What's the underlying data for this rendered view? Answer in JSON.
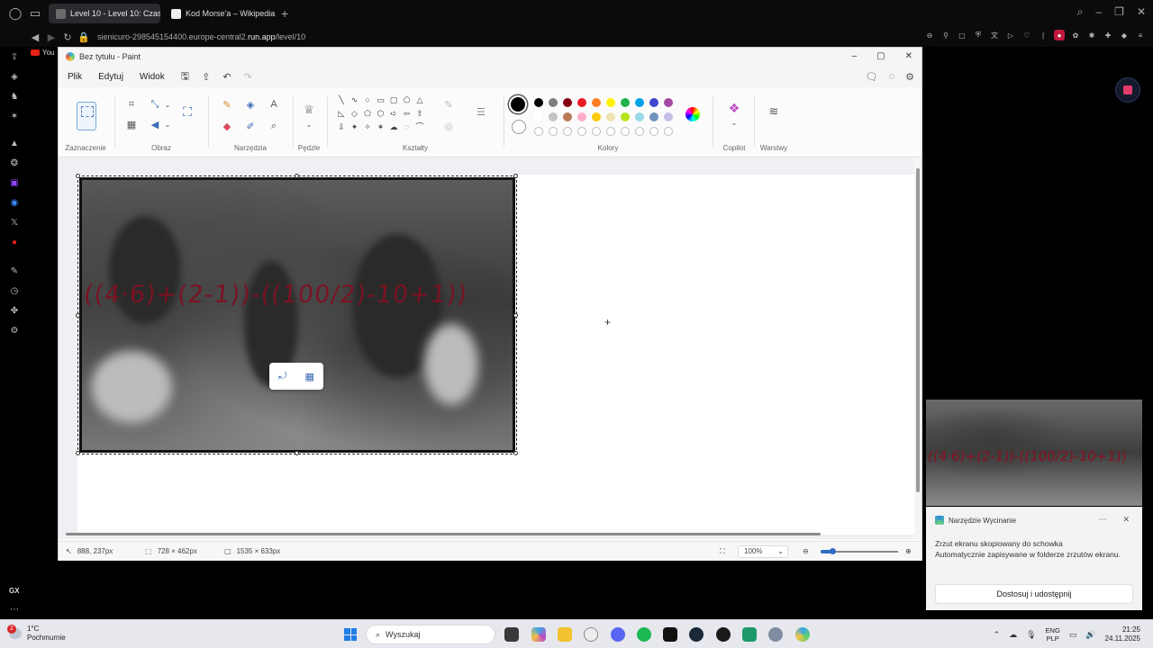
{
  "browser": {
    "tabs": [
      {
        "label": "Level 10 - Level 10: Czas",
        "active": true
      },
      {
        "label": "Kod Morse'a – Wikipedia,",
        "active": false
      }
    ],
    "url_prefix": "sienicuro-298545154400.europe-central2.",
    "url_domain": "run.app",
    "url_path": "/level/10",
    "youtube_label": "You"
  },
  "paint": {
    "title": "Bez tytułu - Paint",
    "menu": [
      "Plik",
      "Edytuj",
      "Widok"
    ],
    "groups": {
      "selection": "Zaznaczenie",
      "image": "Obraz",
      "tools": "Narzędzia",
      "brushes": "Pędzle",
      "shapes": "Kształty",
      "colors": "Kolory",
      "copilot": "Copilot",
      "layers": "Warstwy"
    },
    "palette_row1": [
      "#000000",
      "#7f7f7f",
      "#880015",
      "#ed1c24",
      "#ff7f27",
      "#fff200",
      "#22b14c",
      "#00a2e8",
      "#3f48cc",
      "#a349a4"
    ],
    "palette_row2": [
      "#ffffff",
      "#c3c3c3",
      "#b97a57",
      "#ffaec9",
      "#ffc90e",
      "#efe4b0",
      "#b5e61d",
      "#99d9ea",
      "#7092be",
      "#c8bfe7"
    ],
    "formula": "((4·6)+(2-1))-((100/2)-10+1))",
    "status": {
      "cursor_pos": "888, 237px",
      "selection_size": "728 × 462px",
      "canvas_size": "1535 × 633px",
      "zoom": "100%",
      "zoom_level": 0.15
    }
  },
  "notification": {
    "app": "Narzędzie Wycinanie",
    "line1": "Zrzut ekranu skopiowany do schowka",
    "line2": "Automatycznie zapisywane w folderze zrzutów ekranu.",
    "button": "Dostosuj i udostępnij"
  },
  "sidebar": {
    "gx": "GX"
  },
  "taskbar": {
    "weather_badge": "2",
    "temp": "1°C",
    "condition": "Pochmurnie",
    "search_label": "Wyszukaj",
    "lang1": "ENG",
    "lang2": "PLP",
    "time": "21:25",
    "date": "24.11.2025"
  }
}
